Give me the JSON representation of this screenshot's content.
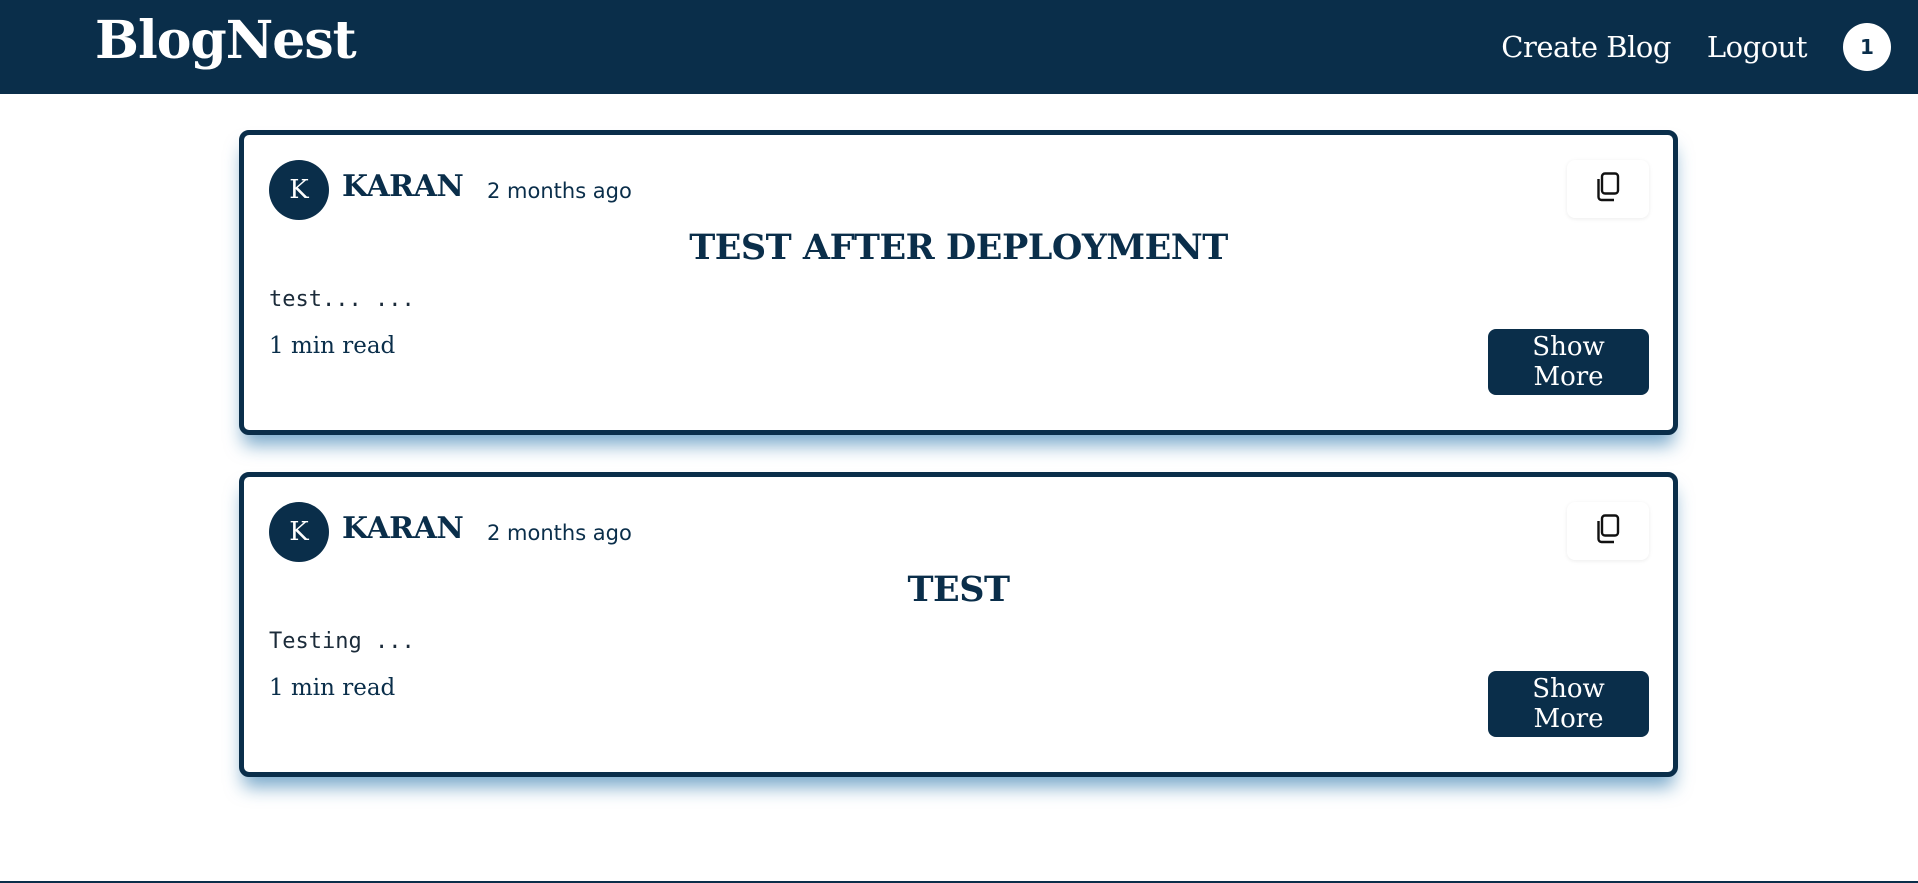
{
  "header": {
    "brand": "BlogNest",
    "nav": {
      "create_blog": "Create Blog",
      "logout": "Logout"
    },
    "notification_count": "1"
  },
  "posts": [
    {
      "avatar_initial": "K",
      "author": "KARAN",
      "time_ago": "2 months ago",
      "title": "TEST AFTER DEPLOYMENT",
      "excerpt": "test... ...",
      "read_time": "1 min read",
      "show_more_label": "Show More",
      "copy_icon": "copy-icon"
    },
    {
      "avatar_initial": "K",
      "author": "KARAN",
      "time_ago": "2 months ago",
      "title": "TEST",
      "excerpt": "Testing ...",
      "read_time": "1 min read",
      "show_more_label": "Show More",
      "copy_icon": "copy-icon"
    }
  ],
  "colors": {
    "primary": "#0a2e4a",
    "background": "#ffffff",
    "card_shadow": "#0e64a0"
  }
}
